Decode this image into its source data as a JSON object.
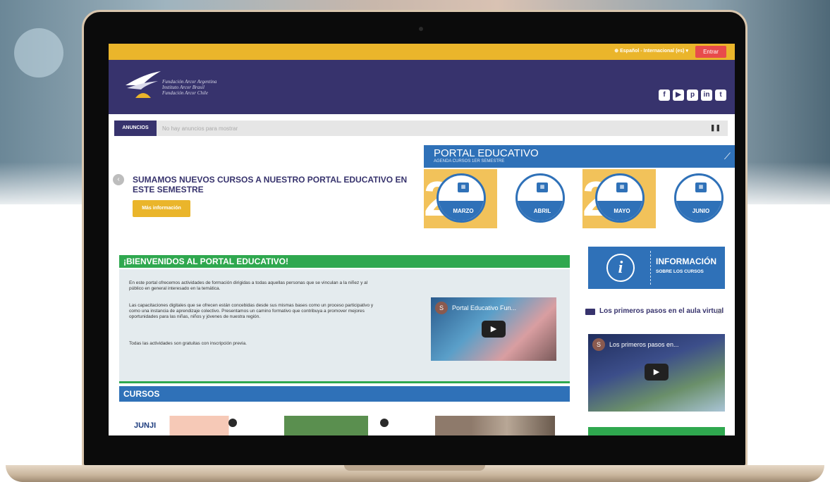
{
  "topbar": {
    "language": "Español - Internacional (es)",
    "login_button": "Entrar"
  },
  "header": {
    "logo_lines": [
      "Fundación Arcor Argentina",
      "Instituto Arcor Brasil",
      "Fundación Arcor Chile"
    ],
    "social_icons": [
      "facebook-icon",
      "youtube-icon",
      "pinterest-icon",
      "linkedin-icon",
      "twitter-icon"
    ]
  },
  "announcements": {
    "tag": "ANUNCIOS",
    "text": "No hay anuncios para mostrar"
  },
  "slider": {
    "title": "SUMAMOS NUEVOS CURSOS A NUESTRO PORTAL EDUCATIVO EN ESTE SEMESTRE",
    "button": "Más información"
  },
  "promo": {
    "title": "PORTAL EDUCATIVO",
    "subtitle": "AGENDA CURSOS 1ER SEMESTRE",
    "months": [
      "MARZO",
      "ABRIL",
      "MAYO",
      "JUNIO"
    ],
    "digit": "2"
  },
  "welcome": {
    "title": "¡BIENVENIDOS AL PORTAL EDUCATIVO!",
    "paragraphs": [
      "En este portal ofrecemos actividades de formación dirigidas a todas aquellas personas que se vinculan a la niñez y al público en general interesado en la temática.",
      "Las capacitaciones digitales que se ofrecen están concebidas desde sus mismas bases como un proceso participativo y como una instancia de aprendizaje colectivo. Presentamos un camino formativo que contribuya a promover mejores oportunidades para las niñas, niños y jóvenes de nuestra región.",
      "Todas las actividades son gratuitas con inscripción previa."
    ],
    "video": {
      "channel_letter": "S",
      "title": "Portal Educativo Fun..."
    }
  },
  "cursos": {
    "title": "CURSOS",
    "first_card_label": "JUNJI"
  },
  "sidebar": {
    "info_title": "INFORMACIÓN",
    "info_subtitle": "SOBRE LOS CURSOS",
    "video_heading": "Los primeros pasos en el aula virtual",
    "video": {
      "channel_letter": "S",
      "title": "Los primeros pasos en..."
    }
  },
  "colors": {
    "topbar": "#eab52b",
    "header": "#37336d",
    "blue": "#2f71b8",
    "green": "#2fa84f",
    "login": "#e84b4b"
  }
}
